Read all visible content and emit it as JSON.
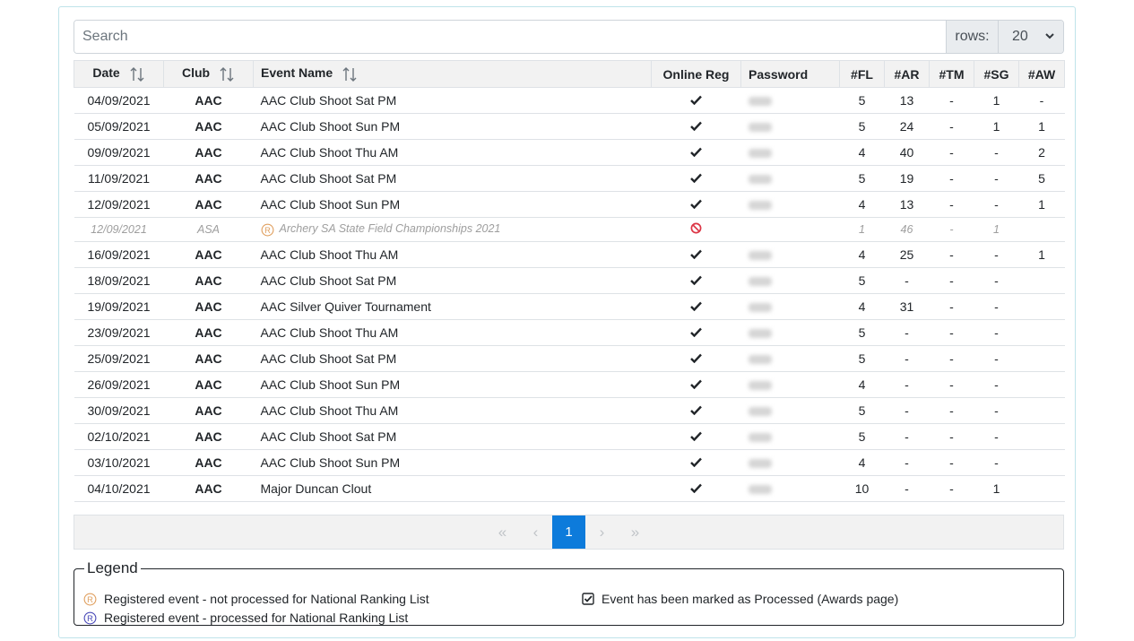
{
  "toolbar": {
    "search_placeholder": "Search",
    "rows_label": "rows:",
    "rows_value": "20"
  },
  "table": {
    "headers": {
      "date": "Date",
      "club": "Club",
      "event": "Event Name",
      "online_reg": "Online Reg",
      "password": "Password",
      "fl": "#FL",
      "ar": "#AR",
      "tm": "#TM",
      "sg": "#SG",
      "aw": "#AW"
    },
    "rows": [
      {
        "date": "04/09/2021",
        "club": "AAC",
        "event": "AAC Club Shoot Sat PM",
        "online": "check",
        "fl": "5",
        "ar": "13",
        "tm": "-",
        "sg": "1",
        "aw": "-"
      },
      {
        "date": "05/09/2021",
        "club": "AAC",
        "event": "AAC Club Shoot Sun PM",
        "online": "check",
        "fl": "5",
        "ar": "24",
        "tm": "-",
        "sg": "1",
        "aw": "1"
      },
      {
        "date": "09/09/2021",
        "club": "AAC",
        "event": "AAC Club Shoot Thu AM",
        "online": "check",
        "fl": "4",
        "ar": "40",
        "tm": "-",
        "sg": "-",
        "aw": "2"
      },
      {
        "date": "11/09/2021",
        "club": "AAC",
        "event": "AAC Club Shoot Sat PM",
        "online": "check",
        "fl": "5",
        "ar": "19",
        "tm": "-",
        "sg": "-",
        "aw": "5"
      },
      {
        "date": "12/09/2021",
        "club": "AAC",
        "event": "AAC Club Shoot Sun PM",
        "online": "check",
        "fl": "4",
        "ar": "13",
        "tm": "-",
        "sg": "-",
        "aw": "1"
      },
      {
        "date": "12/09/2021",
        "club": "ASA",
        "event": "Archery SA State Field Championships 2021",
        "online": "blocked",
        "registered": true,
        "muted": true,
        "fl": "1",
        "ar": "46",
        "tm": "-",
        "sg": "1",
        "aw": ""
      },
      {
        "date": "16/09/2021",
        "club": "AAC",
        "event": "AAC Club Shoot Thu AM",
        "online": "check",
        "fl": "4",
        "ar": "25",
        "tm": "-",
        "sg": "-",
        "aw": "1"
      },
      {
        "date": "18/09/2021",
        "club": "AAC",
        "event": "AAC Club Shoot Sat PM",
        "online": "check",
        "fl": "5",
        "ar": "-",
        "tm": "-",
        "sg": "-",
        "aw": ""
      },
      {
        "date": "19/09/2021",
        "club": "AAC",
        "event": "AAC Silver Quiver Tournament",
        "online": "check",
        "fl": "4",
        "ar": "31",
        "tm": "-",
        "sg": "-",
        "aw": ""
      },
      {
        "date": "23/09/2021",
        "club": "AAC",
        "event": "AAC Club Shoot Thu AM",
        "online": "check",
        "fl": "5",
        "ar": "-",
        "tm": "-",
        "sg": "-",
        "aw": ""
      },
      {
        "date": "25/09/2021",
        "club": "AAC",
        "event": "AAC Club Shoot Sat PM",
        "online": "check",
        "fl": "5",
        "ar": "-",
        "tm": "-",
        "sg": "-",
        "aw": ""
      },
      {
        "date": "26/09/2021",
        "club": "AAC",
        "event": "AAC Club Shoot Sun PM",
        "online": "check",
        "fl": "4",
        "ar": "-",
        "tm": "-",
        "sg": "-",
        "aw": ""
      },
      {
        "date": "30/09/2021",
        "club": "AAC",
        "event": "AAC Club Shoot Thu AM",
        "online": "check",
        "fl": "5",
        "ar": "-",
        "tm": "-",
        "sg": "-",
        "aw": ""
      },
      {
        "date": "02/10/2021",
        "club": "AAC",
        "event": "AAC Club Shoot Sat PM",
        "online": "check",
        "fl": "5",
        "ar": "-",
        "tm": "-",
        "sg": "-",
        "aw": ""
      },
      {
        "date": "03/10/2021",
        "club": "AAC",
        "event": "AAC Club Shoot Sun PM",
        "online": "check",
        "fl": "4",
        "ar": "-",
        "tm": "-",
        "sg": "-",
        "aw": ""
      },
      {
        "date": "04/10/2021",
        "club": "AAC",
        "event": "Major Duncan Clout",
        "online": "check",
        "fl": "10",
        "ar": "-",
        "tm": "-",
        "sg": "1",
        "aw": ""
      }
    ]
  },
  "pagination": {
    "first": "«",
    "prev": "‹",
    "current": "1",
    "next": "›",
    "last": "»"
  },
  "legend": {
    "title": "Legend",
    "items": {
      "registered_not_processed": "Registered event - not processed for National Ranking List",
      "registered_processed": "Registered event - processed for National Ranking List",
      "marked_processed": "Event has been marked as Processed (Awards page)"
    }
  },
  "icons": {
    "sort": "sort-arrows-icon",
    "check": "check-icon",
    "blocked": "ban-icon",
    "registered": "registered-icon",
    "checkbox": "check-square-icon"
  },
  "colors": {
    "registered_orange": "#e0a060",
    "registered_blue": "#4a4ab8",
    "blocked_red": "#dc3545",
    "active_page": "#0d7bdb"
  }
}
